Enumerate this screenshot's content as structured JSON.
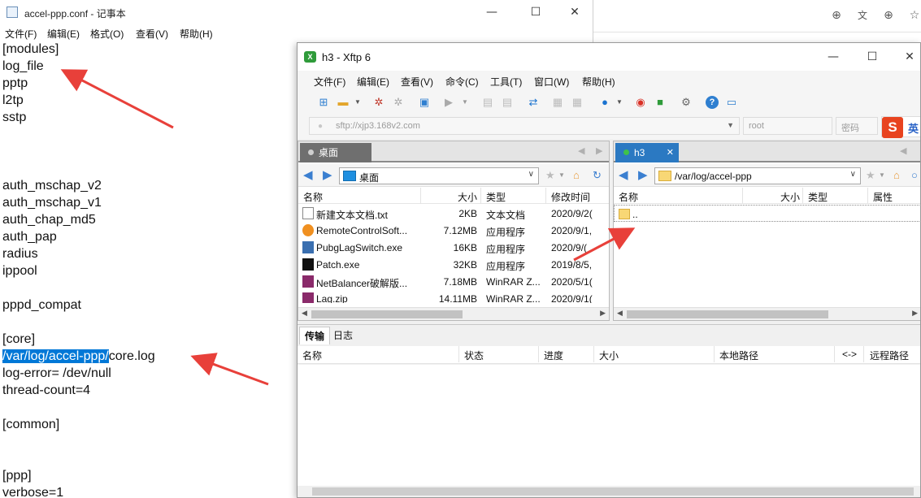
{
  "notepad": {
    "title": "accel-ppp.conf - 记事本",
    "window_controls": [
      "—",
      "☐",
      "✕"
    ],
    "menu": [
      "文件(F)",
      "编辑(E)",
      "格式(O)",
      "查看(V)",
      "帮助(H)"
    ],
    "lines": [
      "[modules]",
      "log_file",
      "pptp",
      "l2tp",
      "sstp",
      "",
      "",
      "",
      "auth_mschap_v2",
      "auth_mschap_v1",
      "auth_chap_md5",
      "auth_pap",
      "radius",
      "ippool",
      "",
      "pppd_compat",
      "",
      "[core]",
      "",
      "log-error= /dev/null",
      "thread-count=4",
      "",
      "[common]",
      "",
      "",
      "",
      "[ppp]",
      "verbose=1"
    ],
    "core_line_highlight": "/var/log/accel-ppp/",
    "core_line_rest": "core.log"
  },
  "browser": {
    "icons": [
      "add-circle-icon",
      "translate-icon",
      "zoom-in-icon",
      "star-icon"
    ]
  },
  "xftp": {
    "title": "h3   - Xftp 6",
    "logo_text": "X",
    "window_controls": [
      "—",
      "☐",
      "✕"
    ],
    "menu": [
      "文件(F)",
      "编辑(E)",
      "查看(V)",
      "命令(C)",
      "工具(T)",
      "窗口(W)",
      "帮助(H)"
    ],
    "address": "sftp://xjp3.168v2.com",
    "user_placeholder": "root",
    "password_placeholder": "密码",
    "ime": {
      "s": "S",
      "mode": "英"
    },
    "local": {
      "tab": "桌面",
      "path": "桌面",
      "headers": [
        "名称",
        "大小",
        "类型",
        "修改时间"
      ],
      "files": [
        {
          "name": "新建文本文档.txt",
          "size": "2KB",
          "type": "文本文档",
          "mtime": "2020/9/2(",
          "icon": "#ffffff"
        },
        {
          "name": "RemoteControlSoft...",
          "size": "7.12MB",
          "type": "应用程序",
          "mtime": "2020/9/1,",
          "icon": "#f09020"
        },
        {
          "name": "PubgLagSwitch.exe",
          "size": "16KB",
          "type": "应用程序",
          "mtime": "2020/9/(",
          "icon": "#3a6fb0"
        },
        {
          "name": "Patch.exe",
          "size": "32KB",
          "type": "应用程序",
          "mtime": "2019/8/5,",
          "icon": "#111111"
        },
        {
          "name": "NetBalancer破解版...",
          "size": "7.18MB",
          "type": "WinRAR Z...",
          "mtime": "2020/5/1(",
          "icon": "#8a2a6a"
        },
        {
          "name": "Lag.zip",
          "size": "14.11MB",
          "type": "WinRAR Z...",
          "mtime": "2020/9/1(",
          "icon": "#8a2a6a"
        }
      ]
    },
    "remote": {
      "tab": "h3",
      "path": "/var/log/accel-ppp",
      "headers": [
        "名称",
        "大小",
        "类型",
        "属性"
      ],
      "files": [
        {
          "name": ".."
        }
      ]
    },
    "transfer_tabs": [
      "传输",
      "日志"
    ],
    "transfer_headers": [
      "名称",
      "状态",
      "进度",
      "大小",
      "本地路径",
      "<->",
      "远程路径"
    ]
  },
  "colors": {
    "selection": "#0078d7",
    "arrow": "#e8403a",
    "active_tab": "#2b79c2",
    "inactive_tab": "#6f6f6f"
  }
}
